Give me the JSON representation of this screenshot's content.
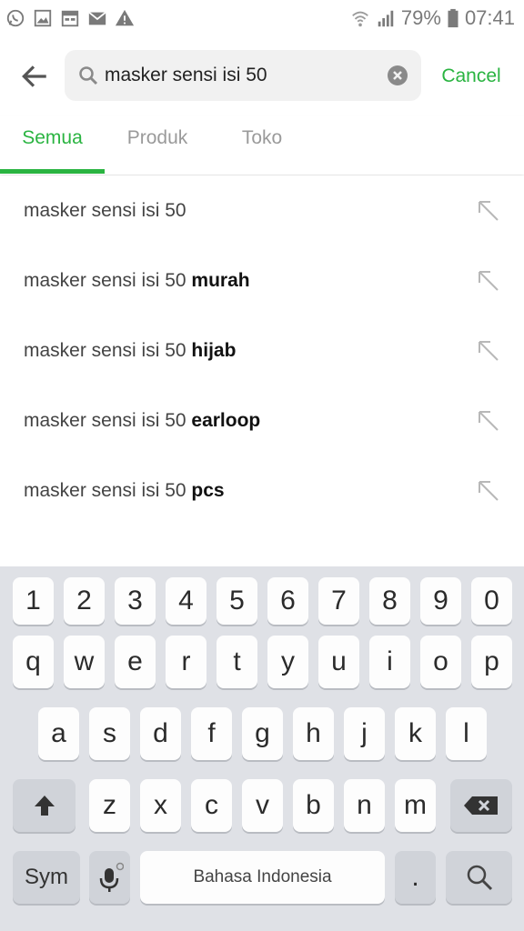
{
  "status_bar": {
    "battery": "79%",
    "time": "07:41",
    "left_icons": [
      "whatsapp-icon",
      "image-icon",
      "calendar-icon",
      "mail-icon",
      "warning-icon"
    ],
    "right_icons": [
      "wifi-icon",
      "signal-icon",
      "battery-icon"
    ]
  },
  "header": {
    "search_value": "masker sensi isi 50",
    "cancel_label": "Cancel"
  },
  "tabs": [
    {
      "label": "Semua",
      "active": true
    },
    {
      "label": "Produk",
      "active": false
    },
    {
      "label": "Toko",
      "active": false
    }
  ],
  "suggestions": [
    {
      "base": "masker sensi isi 50",
      "bold": ""
    },
    {
      "base": "masker sensi isi 50",
      "bold": "murah"
    },
    {
      "base": "masker sensi isi 50",
      "bold": "hijab"
    },
    {
      "base": "masker sensi isi 50",
      "bold": "earloop"
    },
    {
      "base": "masker sensi isi 50",
      "bold": "pcs"
    }
  ],
  "keyboard": {
    "row_numbers": [
      "1",
      "2",
      "3",
      "4",
      "5",
      "6",
      "7",
      "8",
      "9",
      "0"
    ],
    "row_1": [
      "q",
      "w",
      "e",
      "r",
      "t",
      "y",
      "u",
      "i",
      "o",
      "p"
    ],
    "row_2": [
      "a",
      "s",
      "d",
      "f",
      "g",
      "h",
      "j",
      "k",
      "l"
    ],
    "row_3": [
      "z",
      "x",
      "c",
      "v",
      "b",
      "n",
      "m"
    ],
    "sym_label": "Sym",
    "space_label": "Bahasa Indonesia",
    "period_label": "."
  },
  "colors": {
    "accent": "#2ab441",
    "keyboard_bg": "#dfe1e6"
  }
}
